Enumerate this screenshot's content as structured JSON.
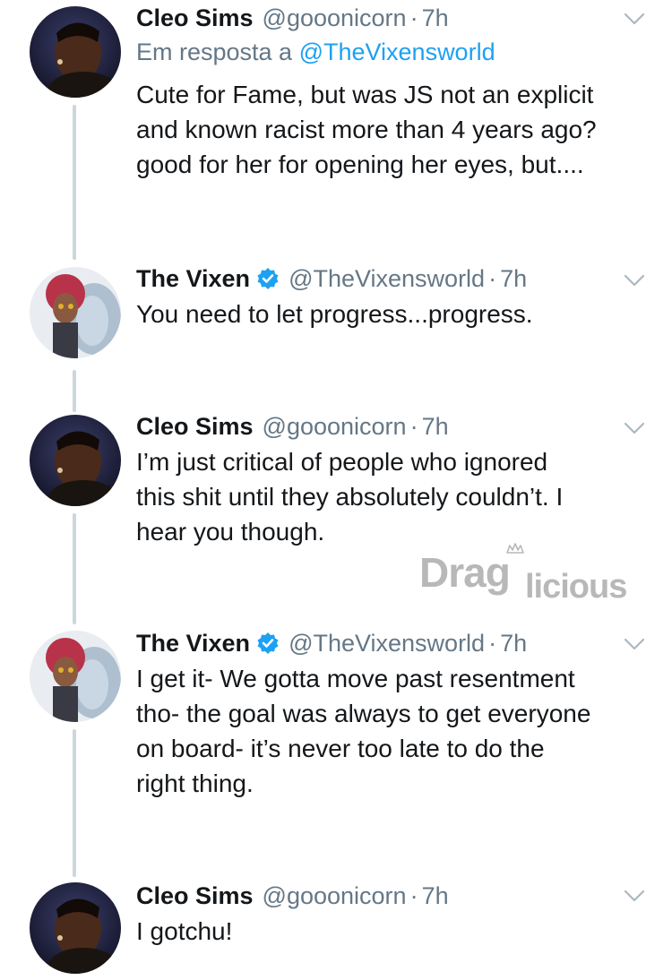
{
  "thread": {
    "tweets": [
      {
        "name": "Cleo Sims",
        "verified": false,
        "handle": "@gooonicorn",
        "separator": "·",
        "time": "7h",
        "reply_prefix": "Em resposta a ",
        "reply_mention": "@TheVixensworld",
        "text": "Cute for Fame, but was JS not an explicit\nand known racist more than 4 years ago?\ngood for her for opening her eyes, but...."
      },
      {
        "name": "The Vixen",
        "verified": true,
        "handle": "@TheVixensworld",
        "separator": "·",
        "time": "7h",
        "text": "You need to let progress...progress."
      },
      {
        "name": "Cleo Sims",
        "verified": false,
        "handle": "@gooonicorn",
        "separator": "·",
        "time": "7h",
        "text": "I’m just critical of people who ignored\nthis shit until they absolutely couldn’t. I\nhear you though."
      },
      {
        "name": "The Vixen",
        "verified": true,
        "handle": "@TheVixensworld",
        "separator": "·",
        "time": "7h",
        "text": "I get it- We gotta move past resentment\ntho- the goal was always to get everyone\non board- it’s never too late to do the\nright thing."
      },
      {
        "name": "Cleo Sims",
        "verified": false,
        "handle": "@gooonicorn",
        "separator": "·",
        "time": "7h",
        "text": "I gotchu!"
      }
    ]
  },
  "watermark": {
    "text_a": "Drag",
    "text_b": "licious"
  },
  "colors": {
    "text": "#14171a",
    "muted": "#657786",
    "link": "#1da1f2",
    "connector": "#ccd6dd",
    "verified": "#1da1f2",
    "watermark": "#b8b8b8"
  },
  "icons": {
    "chevron": "chevron-down-icon",
    "verified": "verified-badge-icon",
    "crown": "crown-icon"
  }
}
